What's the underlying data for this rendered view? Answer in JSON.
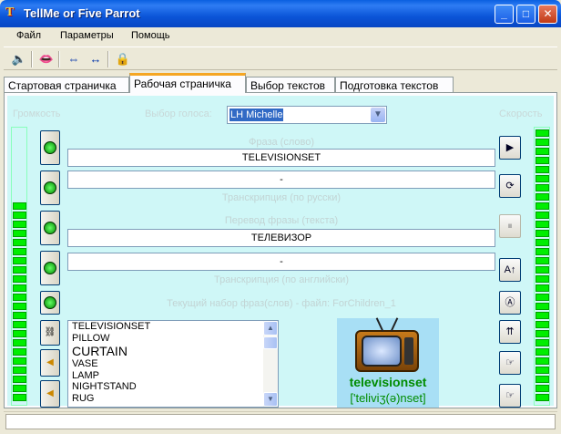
{
  "window": {
    "title": "TellMe or Five Parrot",
    "app_icon": "T"
  },
  "menu": [
    "Файл",
    "Параметры",
    "Помощь"
  ],
  "tabs": [
    "Стартовая страничка",
    "Рабочая страничка",
    "Выбор текстов",
    "Подготовка текстов"
  ],
  "active_tab": 1,
  "workpage": {
    "volume_label": "Громкость",
    "voice_label": "Выбор голоса:",
    "voice_value": "LH Michelle",
    "speed_label": "Скорость",
    "phrase_label": "Фраза (слово)",
    "phrase_value": "TELEVISIONSET",
    "transcription_ru_value": "-",
    "transcription_ru_label": "Транскрипция (по русски)",
    "translation_label": "Перевод фразы (текста)",
    "translation_value": "ТЕЛЕВИЗОР",
    "transcription_en_value": "-",
    "transcription_en_label": "Транскрипция (по английски)",
    "current_set_label": "Текущий набор фраз(слов) - файл: ForChildren_1"
  },
  "word_list": [
    "TELEVISIONSET",
    "PILLOW",
    "CURTAIN",
    "VASE",
    "LAMP",
    "NIGHTSTAND",
    "RUG"
  ],
  "picture": {
    "word": "televisionset",
    "transcription": "['teliviʒ(ə)nset]"
  },
  "volume_level": 0.72,
  "speed_level": 1.0,
  "colors": {
    "panel_bg": "#cff7f7",
    "meter_green": "#00ee00",
    "caption_faded": "#c2d4d4"
  }
}
